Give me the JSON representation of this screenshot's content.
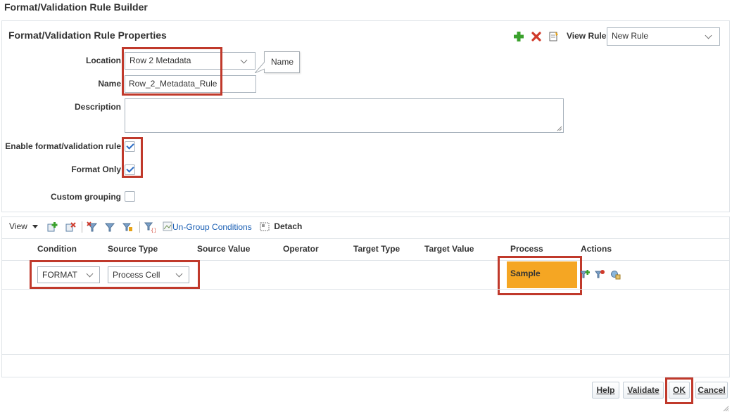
{
  "dialog": {
    "title": "Format/Validation Rule Builder"
  },
  "properties": {
    "title": "Format/Validation Rule Properties",
    "view_rule_label": "View Rule",
    "view_rule_value": "New Rule",
    "location_label": "Location",
    "location_value": "Row 2 Metadata",
    "name_label": "Name",
    "name_value": "Row_2_Metadata_Rule",
    "name_tooltip": "Name",
    "description_label": "Description",
    "description_value": "",
    "enable_label": "Enable format/validation rule",
    "enable_checked": true,
    "format_only_label": "Format Only",
    "format_only_checked": true,
    "custom_grouping_label": "Custom grouping",
    "custom_grouping_checked": false
  },
  "toolbar": {
    "view_label": "View",
    "ungroup_label": "Un-Group Conditions",
    "detach_label": "Detach"
  },
  "table": {
    "headers": [
      "Condition",
      "Source Type",
      "Source Value",
      "Operator",
      "Target Type",
      "Target Value",
      "Process",
      "Actions"
    ],
    "rows": [
      {
        "condition": "FORMAT",
        "source_type": "Process Cell",
        "process": "Sample"
      }
    ]
  },
  "colors": {
    "highlight": "#c0392b",
    "process_fill": "#f5a623",
    "accent_green": "#3aa12c",
    "accent_red": "#d03a2a"
  },
  "buttons": {
    "help": "Help",
    "validate": "Validate",
    "ok": "OK",
    "cancel": "Cancel"
  }
}
